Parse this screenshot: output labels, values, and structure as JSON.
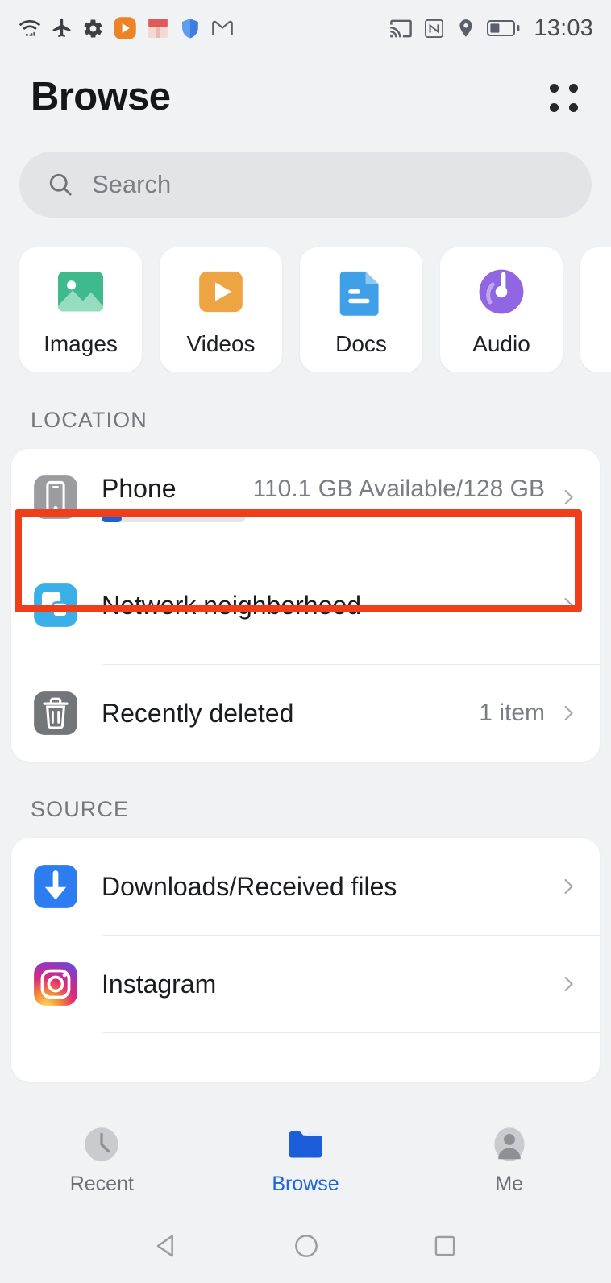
{
  "status_bar": {
    "time": "13:03",
    "left_icons": [
      "wifi-icon",
      "airplane-mode-icon",
      "settings-gear-icon",
      "vlc-app-icon",
      "mailbox-app-icon",
      "security-shield-icon",
      "gmail-icon"
    ],
    "right_icons": [
      "cast-icon",
      "nfc-icon",
      "location-pin-icon",
      "battery-icon"
    ],
    "battery_level_percent": 42
  },
  "header": {
    "title": "Browse",
    "menu_icon": "grid-menu-icon"
  },
  "search": {
    "placeholder": "Search",
    "icon": "search-icon"
  },
  "categories": [
    {
      "label": "Images",
      "icon": "image-icon",
      "color": "#3fba8c"
    },
    {
      "label": "Videos",
      "icon": "video-play-icon",
      "color": "#eda443"
    },
    {
      "label": "Docs",
      "icon": "document-icon",
      "color": "#3fa0e8"
    },
    {
      "label": "Audio",
      "icon": "audio-disc-icon",
      "color": "#9166e3"
    },
    {
      "label": "",
      "icon": "",
      "color": "#ffffff"
    }
  ],
  "sections": [
    {
      "title": "LOCATION",
      "rows": [
        {
          "label": "Phone",
          "value": "110.1 GB Available/128 GB",
          "icon": "phone-device-icon",
          "icon_color": "#9a9ca0",
          "has_progress": true,
          "progress_percent": 14,
          "progress_color": "#1a60d8",
          "highlighted": true
        },
        {
          "label": "Network neighborhood",
          "value": "",
          "icon": "network-neighborhood-icon",
          "icon_color": "#39b0e8",
          "has_progress": false,
          "highlighted": false
        },
        {
          "label": "Recently deleted",
          "value": "1 item",
          "icon": "trash-icon",
          "icon_color": "#737679",
          "has_progress": false,
          "highlighted": false
        }
      ]
    },
    {
      "title": "SOURCE",
      "rows": [
        {
          "label": "Downloads/Received files",
          "value": "",
          "icon": "download-icon",
          "icon_color": "#2b7df0",
          "has_progress": false,
          "highlighted": false
        },
        {
          "label": "Instagram",
          "value": "",
          "icon": "instagram-icon",
          "icon_color": "#d6249f",
          "has_progress": false,
          "highlighted": false
        }
      ]
    }
  ],
  "bottom_nav": [
    {
      "label": "Recent",
      "icon": "clock-icon",
      "active": false
    },
    {
      "label": "Browse",
      "icon": "folder-icon",
      "active": true
    },
    {
      "label": "Me",
      "icon": "person-avatar-icon",
      "active": false
    }
  ],
  "system_nav": [
    "back-triangle-icon",
    "home-circle-icon",
    "recents-square-icon"
  ],
  "colors": {
    "background": "#f1f2f4",
    "card": "#ffffff",
    "accent": "#1b64dd",
    "highlight_border": "#ef3e19",
    "text_primary": "#1a1c1f",
    "text_secondary": "#7a7d83"
  }
}
